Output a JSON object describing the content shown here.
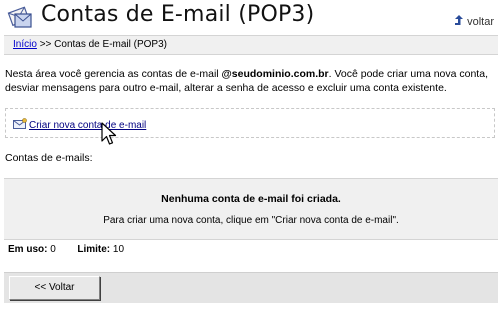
{
  "header": {
    "title": "Contas de E-mail (POP3)",
    "voltar_label": "voltar",
    "logo_icon": "email-envelope-logo-icon",
    "voltar_icon": "arrow-up-back-icon"
  },
  "breadcrumb": {
    "home_label": "Início",
    "separator": ">>",
    "current": "Contas de E-mail (POP3)"
  },
  "intro": {
    "text_before": "Nesta área você gerencia as contas de e-mail ",
    "domain": "@seudominio.com.br",
    "text_after": ". Você pode criar uma nova conta, desviar mensagens para outro e-mail, alterar a senha de acesso e excluir uma conta existente."
  },
  "create": {
    "link_label": "Criar nova conta de e-mail",
    "icon": "new-email-icon"
  },
  "accounts": {
    "section_label": "Contas de e-mails:",
    "empty_headline": "Nenhuma conta de e-mail foi criada.",
    "empty_hint": "Para criar uma nova conta, clique em \"Criar nova conta de e-mail\"."
  },
  "usage": {
    "in_use_label": "Em uso:",
    "in_use_value": "0",
    "limit_label": "Limite:",
    "limit_value": "10"
  },
  "footer": {
    "back_button_label": "<< Voltar"
  },
  "colors": {
    "link": "#0000cc",
    "create_link": "#000080",
    "panel_bg": "#f0f0f0",
    "footer_bg": "#e4e4e4"
  }
}
